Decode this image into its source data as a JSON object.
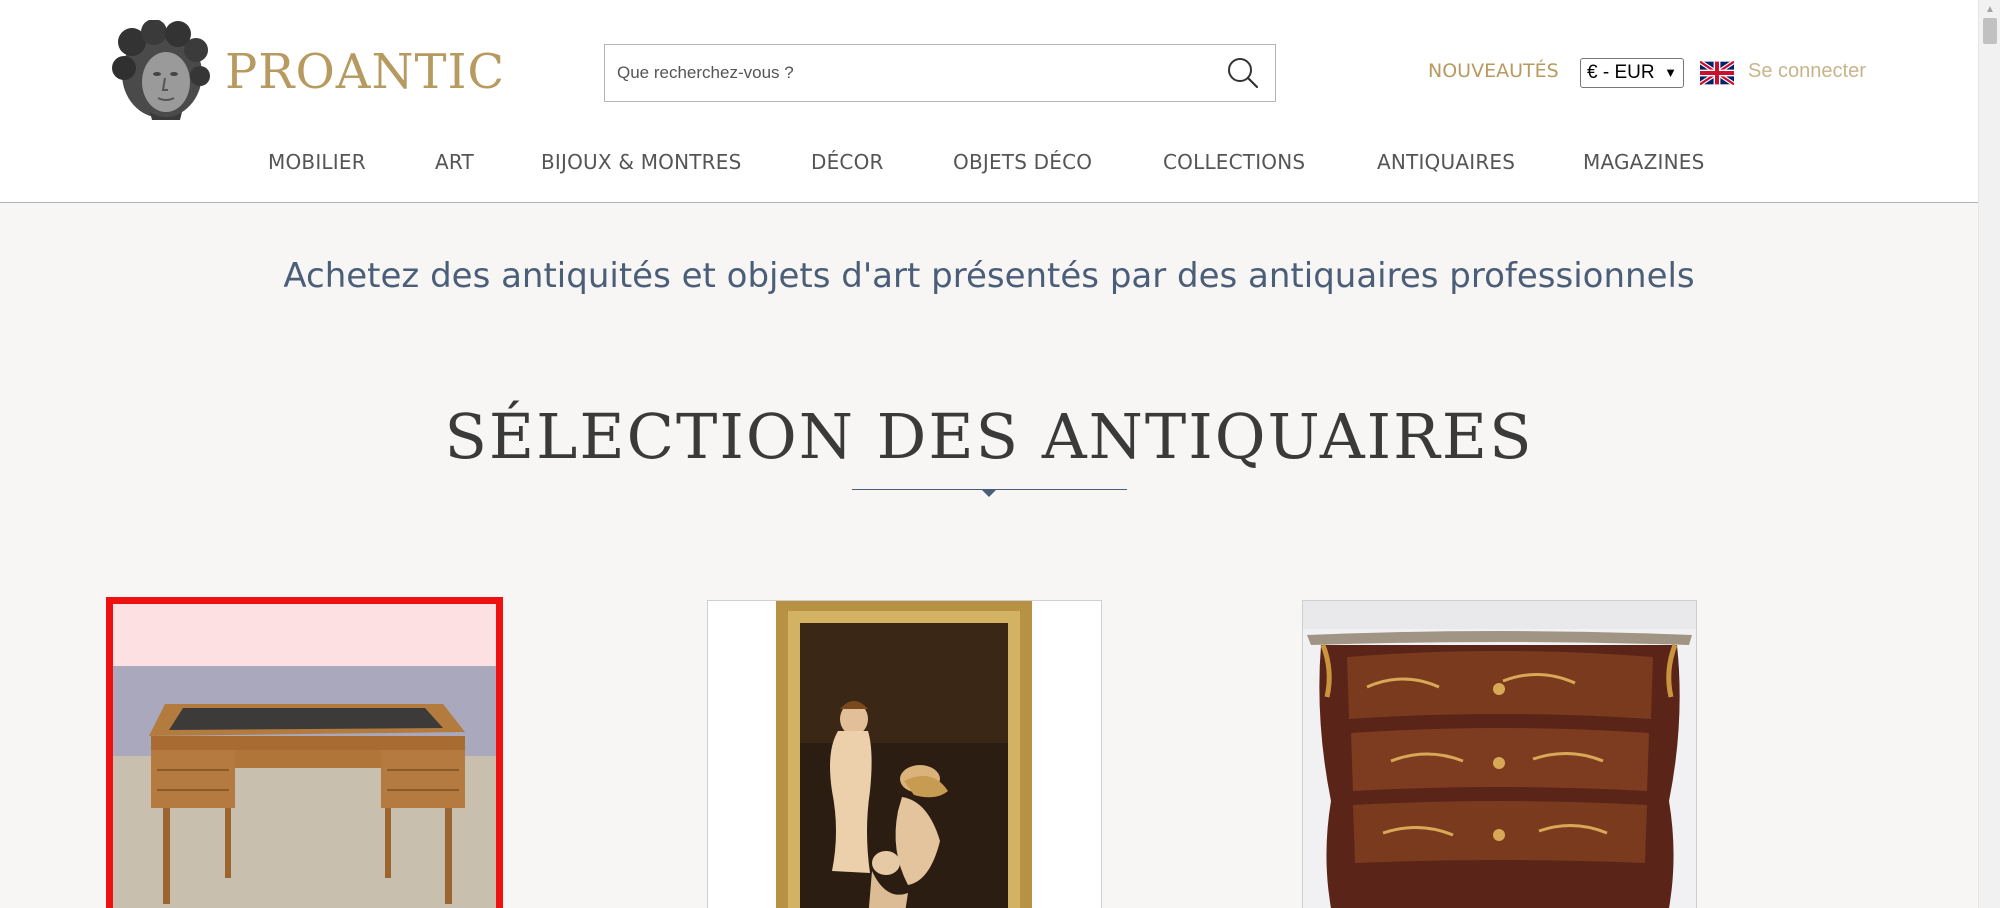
{
  "header": {
    "brand": "PROANTIC",
    "search": {
      "placeholder": "Que recherchez-vous ?"
    },
    "new_link": "NOUVEAUTÉS",
    "currency": {
      "selected": "€ - EUR"
    },
    "login": "Se connecter",
    "language_flag": "uk-flag-icon"
  },
  "nav": {
    "items": [
      {
        "label": "MOBILIER"
      },
      {
        "label": "ART"
      },
      {
        "label": "BIJOUX & MONTRES"
      },
      {
        "label": "DÉCOR"
      },
      {
        "label": "OBJETS DÉCO"
      },
      {
        "label": "COLLECTIONS"
      },
      {
        "label": "ANTIQUAIRES"
      },
      {
        "label": "MAGAZINES"
      }
    ]
  },
  "main": {
    "tagline": "Achetez des antiquités et objets d'art présentés par des antiquaires professionnels",
    "section_title": "SÉLECTION DES ANTIQUAIRES"
  },
  "colors": {
    "brand_gold": "#b79a5f",
    "tagline_blue": "#4b5e79",
    "selected_outline": "#ee1111"
  },
  "icons": [
    "logo-head-icon",
    "search-icon",
    "uk-flag-icon",
    "chevron-down-icon"
  ]
}
